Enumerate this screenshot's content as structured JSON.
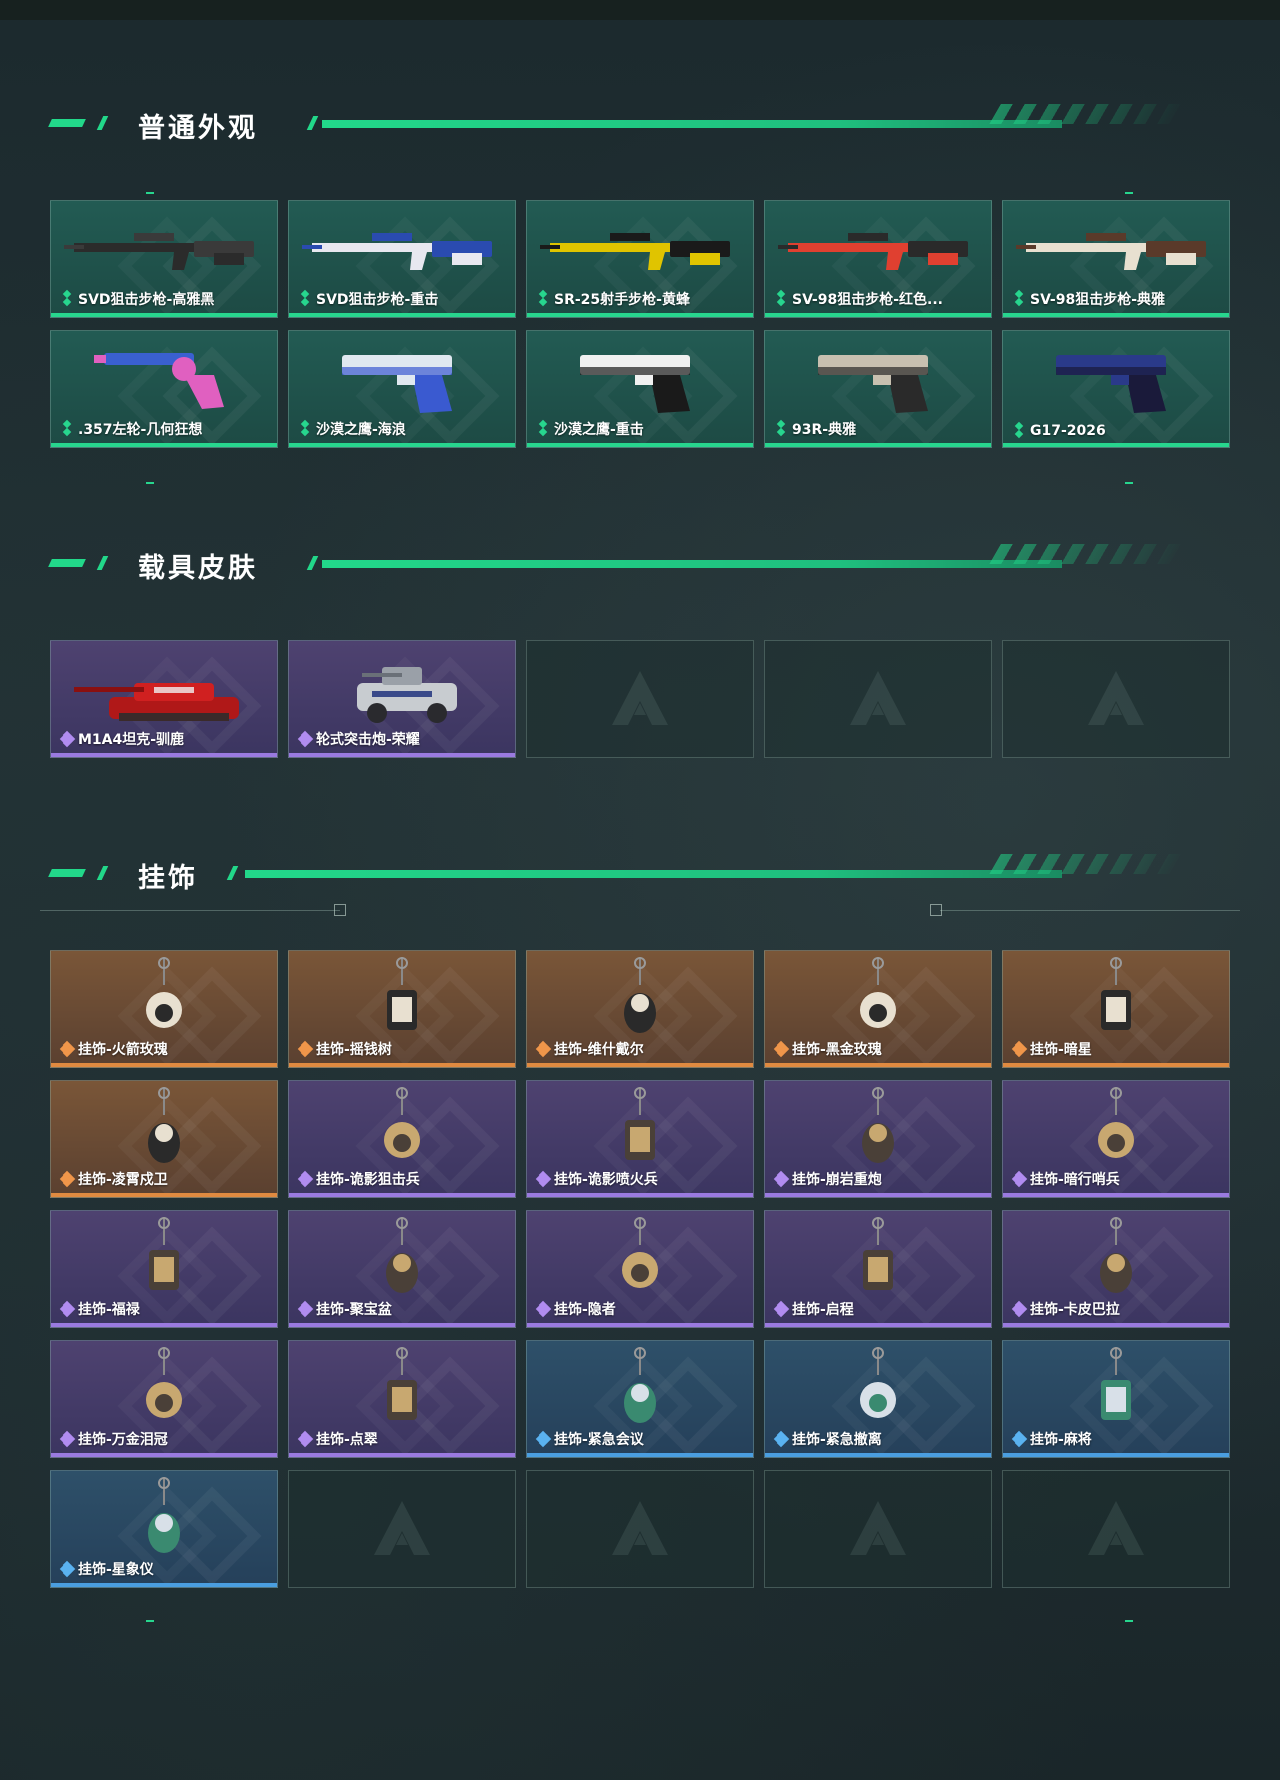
{
  "sections": {
    "normal": {
      "title": "普通外观",
      "items": [
        {
          "label": "SVD狙击步枪-高雅黑",
          "rarity": "green",
          "icon": "rifle-icon"
        },
        {
          "label": "SVD狙击步枪-重击",
          "rarity": "green",
          "icon": "rifle-icon"
        },
        {
          "label": "SR-25射手步枪-黄蜂",
          "rarity": "green",
          "icon": "rifle-icon"
        },
        {
          "label": "SV-98狙击步枪-红色...",
          "rarity": "green",
          "icon": "rifle-icon"
        },
        {
          "label": "SV-98狙击步枪-典雅",
          "rarity": "green",
          "icon": "rifle-icon"
        },
        {
          "label": ".357左轮-几何狂想",
          "rarity": "green",
          "icon": "revolver-icon"
        },
        {
          "label": "沙漠之鹰-海浪",
          "rarity": "green",
          "icon": "pistol-icon"
        },
        {
          "label": "沙漠之鹰-重击",
          "rarity": "green",
          "icon": "pistol-icon"
        },
        {
          "label": "93R-典雅",
          "rarity": "green",
          "icon": "pistol-icon"
        },
        {
          "label": "G17-2026",
          "rarity": "green",
          "icon": "pistol-icon"
        }
      ]
    },
    "vehicle": {
      "title": "载具皮肤",
      "items": [
        {
          "label": "M1A4坦克-驯鹿",
          "rarity": "purple",
          "icon": "tank-icon"
        },
        {
          "label": "轮式突击炮-荣耀",
          "rarity": "purple",
          "icon": "armored-car-icon"
        }
      ]
    },
    "charms": {
      "title": "挂饰",
      "items": [
        {
          "label": "挂饰-火箭玫瑰",
          "rarity": "orange"
        },
        {
          "label": "挂饰-摇钱树",
          "rarity": "orange"
        },
        {
          "label": "挂饰-维什戴尔",
          "rarity": "orange"
        },
        {
          "label": "挂饰-黑金玫瑰",
          "rarity": "orange"
        },
        {
          "label": "挂饰-暗星",
          "rarity": "orange"
        },
        {
          "label": "挂饰-凌霄戍卫",
          "rarity": "orange"
        },
        {
          "label": "挂饰-诡影狙击兵",
          "rarity": "purple"
        },
        {
          "label": "挂饰-诡影喷火兵",
          "rarity": "purple"
        },
        {
          "label": "挂饰-崩岩重炮",
          "rarity": "purple"
        },
        {
          "label": "挂饰-暗行哨兵",
          "rarity": "purple"
        },
        {
          "label": "挂饰-福禄",
          "rarity": "purple"
        },
        {
          "label": "挂饰-聚宝盆",
          "rarity": "purple"
        },
        {
          "label": "挂饰-隐者",
          "rarity": "purple"
        },
        {
          "label": "挂饰-启程",
          "rarity": "purple"
        },
        {
          "label": "挂饰-卡皮巴拉",
          "rarity": "purple"
        },
        {
          "label": "挂饰-万金泪冠",
          "rarity": "purple"
        },
        {
          "label": "挂饰-点翠",
          "rarity": "purple"
        },
        {
          "label": "挂饰-紧急会议",
          "rarity": "blue"
        },
        {
          "label": "挂饰-紧急撤离",
          "rarity": "blue"
        },
        {
          "label": "挂饰-麻将",
          "rarity": "blue"
        },
        {
          "label": "挂饰-星象仪",
          "rarity": "blue"
        }
      ]
    }
  },
  "colors": {
    "accent": "#22d88a",
    "green_card": "#225b53",
    "purple_card": "#4e4270",
    "orange_card": "#7a5638",
    "blue_card": "#2e5069"
  }
}
